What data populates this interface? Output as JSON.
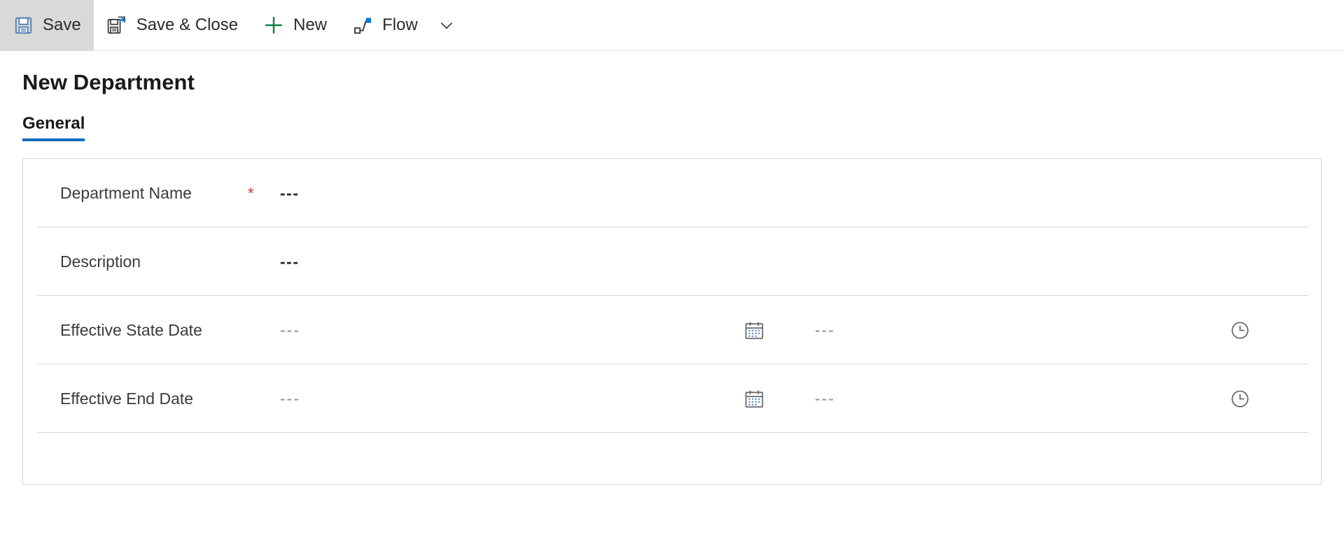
{
  "commandbar": {
    "items": [
      {
        "id": "save",
        "label": "Save",
        "icon": "save-icon",
        "selected": true
      },
      {
        "id": "save-close",
        "label": "Save & Close",
        "icon": "save-and-close-icon",
        "selected": false
      },
      {
        "id": "new",
        "label": "New",
        "icon": "plus-icon",
        "selected": false
      },
      {
        "id": "flow",
        "label": "Flow",
        "icon": "flow-icon",
        "selected": false
      }
    ],
    "overflow_caret": "chevron-down-icon"
  },
  "page": {
    "title": "New Department"
  },
  "tabs": [
    {
      "id": "general",
      "label": "General",
      "active": true
    }
  ],
  "form": {
    "rows": [
      {
        "id": "department-name",
        "label": "Department Name",
        "required": true,
        "value": "---",
        "type": "text"
      },
      {
        "id": "description",
        "label": "Description",
        "required": false,
        "value": "---",
        "type": "text"
      },
      {
        "id": "effective-state-date",
        "label": "Effective State Date",
        "required": false,
        "date_value": "---",
        "time_value": "---",
        "type": "datetime",
        "date_icon": "calendar-icon",
        "time_icon": "clock-icon"
      },
      {
        "id": "effective-end-date",
        "label": "Effective End Date",
        "required": false,
        "date_value": "---",
        "time_value": "---",
        "type": "datetime",
        "date_icon": "calendar-icon",
        "time_icon": "clock-icon"
      }
    ],
    "required_marker": "*"
  },
  "colors": {
    "accent": "#0f6cbd",
    "required": "#d13438",
    "selected_command_bg": "#d9d9d9",
    "border": "#d6d6d6",
    "icon_blue": "#0078d4",
    "icon_green": "#107c41"
  }
}
